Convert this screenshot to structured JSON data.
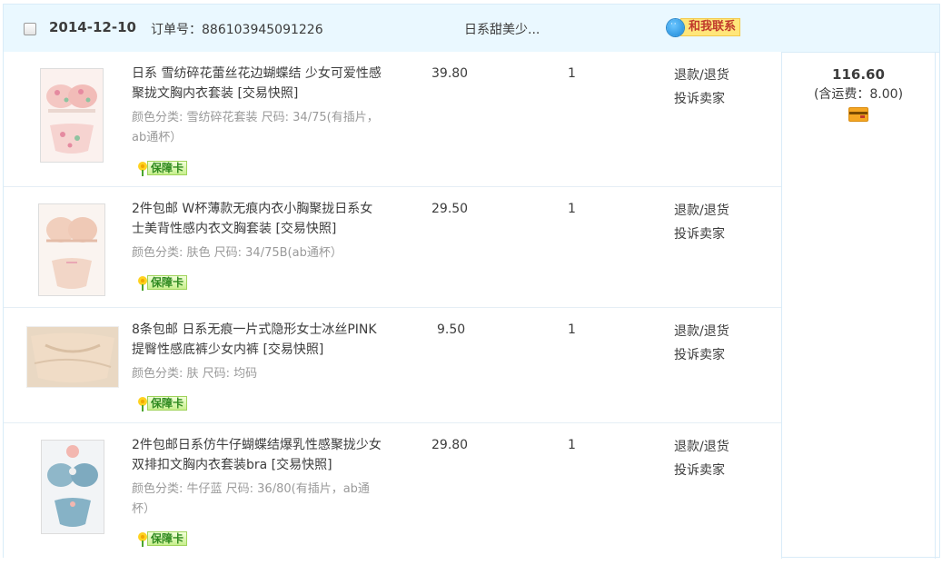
{
  "order": {
    "date": "2014-12-10",
    "order_no_label": "订单号：",
    "order_no": "886103945091226",
    "shop_name": "日系甜美少...",
    "contact_label": "和我联系"
  },
  "items": [
    {
      "title": "日系 雪纺碎花蕾丝花边蝴蝶结 少女可爱性感聚拢文胸内衣套装 [交易快照]",
      "sku": "颜色分类: 雪纺碎花套装 尺码: 34/75(有插片，ab通杯）",
      "badge": "保障卡",
      "price": "39.80",
      "qty": "1",
      "action_refund": "退款/退货",
      "action_complain": "投诉卖家"
    },
    {
      "title": "2件包邮 W杯薄款无痕内衣小胸聚拢日系女士美背性感内衣文胸套装 [交易快照]",
      "sku": "颜色分类: 肤色 尺码: 34/75B(ab通杯）",
      "badge": "保障卡",
      "price": "29.50",
      "qty": "1",
      "action_refund": "退款/退货",
      "action_complain": "投诉卖家"
    },
    {
      "title": "8条包邮 日系无痕一片式隐形女士冰丝PINK提臀性感底裤少女内裤 [交易快照]",
      "sku": "颜色分类: 肤 尺码: 均码",
      "badge": "保障卡",
      "price": "9.50",
      "qty": "1",
      "action_refund": "退款/退货",
      "action_complain": "投诉卖家"
    },
    {
      "title": "2件包邮日系仿牛仔蝴蝶结爆乳性感聚拢少女双排扣文胸内衣套装bra [交易快照]",
      "sku": "颜色分类: 牛仔蓝 尺码: 36/80(有插片，ab通杯）",
      "badge": "保障卡",
      "price": "29.80",
      "qty": "1",
      "action_refund": "退款/退货",
      "action_complain": "投诉卖家"
    }
  ],
  "total": {
    "amount": "116.60",
    "shipping": "(含运费：8.00)"
  },
  "icons": {
    "contact": "chat-bubble-icon",
    "badge": "flower-icon",
    "payment": "card-icon"
  },
  "colors": {
    "header_bg": "#eaf8ff",
    "border": "#d9ecf8",
    "contact_label": "#c0392b",
    "badge_green": "#2f8a1f",
    "muted_text": "#9a9a9a"
  }
}
